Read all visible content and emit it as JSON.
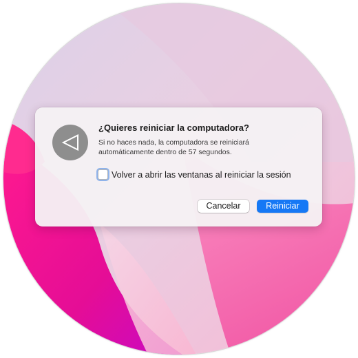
{
  "dialog": {
    "title": "¿Quieres reiniciar la computadora?",
    "message": "Si no haces nada, la computadora se reiniciará automáticamente dentro de 57 segundos.",
    "checkbox_label": "Volver a abrir las ventanas al reiniciar la sesión",
    "checkbox_checked": false,
    "icon": "restart-arrow-icon",
    "buttons": {
      "cancel_label": "Cancelar",
      "default_label": "Reiniciar"
    }
  },
  "colors": {
    "default_button": "#1678f5",
    "dialog_background": "#f5f1f4",
    "icon_background": "#8e8e8e"
  },
  "wallpaper": {
    "palette": [
      "#f4c8dd",
      "#f577b4",
      "#e81596",
      "#c708c8"
    ]
  }
}
